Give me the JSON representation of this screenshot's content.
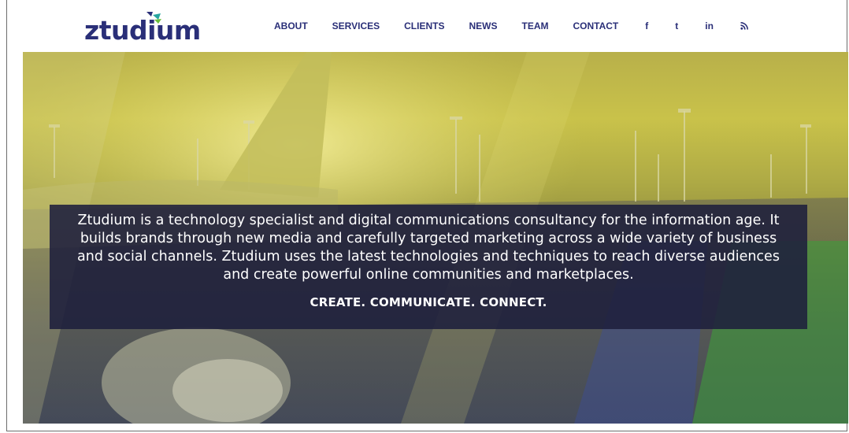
{
  "brand": {
    "name": "ztudium",
    "colors": {
      "primary": "#2a2f78",
      "accent_teal": "#27a6a0",
      "accent_green": "#6cbf3c"
    }
  },
  "nav": {
    "items": [
      {
        "id": "about",
        "label": "ABOUT"
      },
      {
        "id": "services",
        "label": "SERVICES"
      },
      {
        "id": "clients",
        "label": "CLIENTS"
      },
      {
        "id": "news",
        "label": "NEWS"
      },
      {
        "id": "team",
        "label": "TEAM"
      },
      {
        "id": "contact",
        "label": "CONTACT"
      }
    ]
  },
  "social": [
    {
      "id": "facebook",
      "glyph": "f",
      "icon": "facebook-icon"
    },
    {
      "id": "tumblr",
      "glyph": "t",
      "icon": "tumblr-icon"
    },
    {
      "id": "linkedin",
      "glyph": "in",
      "icon": "linkedin-icon"
    },
    {
      "id": "rss",
      "glyph": "",
      "icon": "rss-icon"
    }
  ],
  "hero": {
    "description": "Ztudium is a technology specialist and digital communications consultancy for the information age. It builds brands through new media and carefully targeted marketing across a wide variety of business and social channels. Ztudium uses the latest technologies and techniques to reach diverse audiences and create powerful online communities and marketplaces.",
    "tagline": "CREATE. COMMUNICATE. CONNECT.",
    "overlay_color": "#1e1f3c"
  }
}
